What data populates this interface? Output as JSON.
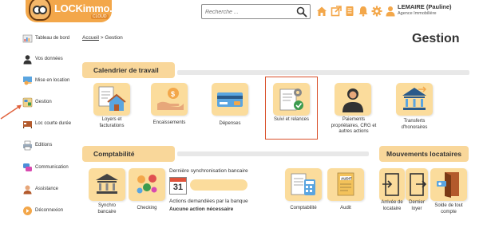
{
  "header": {
    "logo_text": "LOCKimmo.io",
    "logo_sub": "CLOUD",
    "search_placeholder": "Recherche ...",
    "icons": [
      "home-icon",
      "external-link-icon",
      "document-icon",
      "bell-icon",
      "gear-icon",
      "user-icon"
    ],
    "user_name": "LEMAIRE (Pauline)",
    "agency": "Agence Immobilière"
  },
  "sidebar": {
    "items": [
      {
        "label": "Tableau de bord",
        "icon": "dashboard-icon"
      },
      {
        "label": "Vos données",
        "icon": "person-icon"
      },
      {
        "label": "Mise en location",
        "icon": "key-icon"
      },
      {
        "label": "Gestion",
        "icon": "management-icon"
      },
      {
        "label": "Loc courte durée",
        "icon": "bed-icon"
      },
      {
        "label": "Editions",
        "icon": "print-icon"
      },
      {
        "label": "Communication",
        "icon": "chat-icon"
      },
      {
        "label": "Assistance",
        "icon": "support-icon"
      },
      {
        "label": "Déconnexion",
        "icon": "logout-icon"
      }
    ]
  },
  "breadcrumb": {
    "home": "Accueil",
    "separator": ">",
    "current": "Gestion"
  },
  "page_title": "Gestion",
  "calendrier": {
    "title": "Calendrier de travail",
    "tiles": [
      {
        "label": "Loyers et facturations",
        "icon": "rent-invoice-icon"
      },
      {
        "label": "Encaissements",
        "icon": "payment-hand-icon"
      },
      {
        "label": "Dépenses",
        "icon": "expenses-icon"
      },
      {
        "label": "Suivi et relances",
        "icon": "follow-up-icon",
        "selected": true
      },
      {
        "label": "Paiements propriétaires, CRG et autres actions",
        "icon": "owner-payment-icon"
      },
      {
        "label": "Transferts d'honoraires",
        "icon": "fee-transfer-icon"
      }
    ]
  },
  "comptabilite": {
    "title": "Comptabilité",
    "tiles": [
      {
        "label": "Synchro bancaire",
        "icon": "bank-sync-icon"
      },
      {
        "label": "Checking",
        "icon": "checking-icon"
      },
      {
        "label": "Comptabilité",
        "icon": "accounting-icon"
      },
      {
        "label": "Audit",
        "icon": "audit-icon"
      }
    ],
    "last_sync_label": "Dernière synchronisation bancaire",
    "calendar_day": "31",
    "requests_label": "Actions demandées par la banque",
    "requests_status": "Aucune action nécessaire"
  },
  "mouvements": {
    "title": "Mouvements locataires",
    "tiles": [
      {
        "label": "Arrivée de locataire",
        "icon": "tenant-arrival-icon"
      },
      {
        "label": "Dernier loyer",
        "icon": "last-rent-icon"
      },
      {
        "label": "Solde de tout compte",
        "icon": "final-settlement-icon"
      }
    ]
  },
  "colors": {
    "accent": "#f3a74a",
    "tile": "#fbdc9c",
    "highlight": "#d9502a"
  }
}
